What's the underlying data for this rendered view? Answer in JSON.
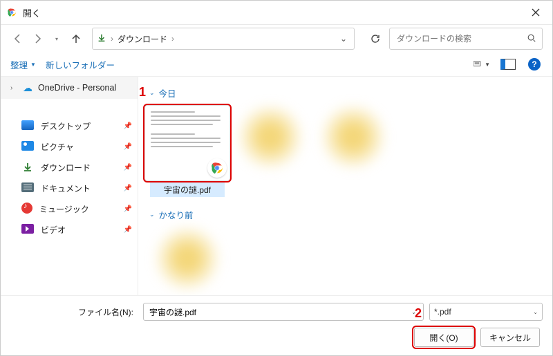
{
  "window": {
    "title": "開く"
  },
  "nav": {
    "downloads_label": "ダウンロード",
    "search_placeholder": "ダウンロードの検索"
  },
  "toolbar": {
    "organize_label": "整理",
    "new_folder_label": "新しいフォルダー"
  },
  "sidebar": {
    "onedrive_label": "OneDrive - Personal",
    "quick_items": [
      {
        "label": "デスクトップ",
        "icon": "desktop"
      },
      {
        "label": "ピクチャ",
        "icon": "pictures"
      },
      {
        "label": "ダウンロード",
        "icon": "downloads"
      },
      {
        "label": "ドキュメント",
        "icon": "docs"
      },
      {
        "label": "ミュージック",
        "icon": "music"
      },
      {
        "label": "ビデオ",
        "icon": "video"
      }
    ]
  },
  "groups": {
    "today_label": "今日",
    "long_ago_label": "かなり前"
  },
  "files": {
    "selected_pdf_name": "宇宙の謎.pdf"
  },
  "callouts": {
    "c1": "1",
    "c2": "2"
  },
  "footer": {
    "filename_label": "ファイル名(N):",
    "filename_value": "宇宙の謎.pdf",
    "filter_value": "*.pdf",
    "open_label": "開く(O)",
    "cancel_label": "キャンセル"
  }
}
